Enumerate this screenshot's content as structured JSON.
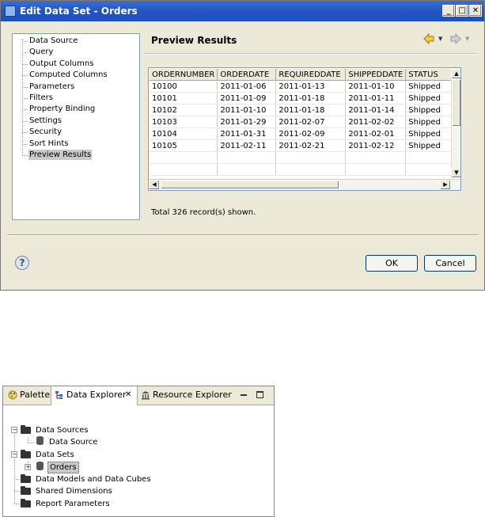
{
  "dialog": {
    "title": "Edit Data Set - Orders",
    "nav_items": [
      "Data Source",
      "Query",
      "Output Columns",
      "Computed Columns",
      "Parameters",
      "Filters",
      "Property Binding",
      "Settings",
      "Security",
      "Sort Hints",
      "Preview Results"
    ],
    "selected_nav": "Preview Results",
    "page_title": "Preview Results",
    "table": {
      "columns": [
        "ORDERNUMBER",
        "ORDERDATE",
        "REQUIREDDATE",
        "SHIPPEDDATE",
        "STATUS"
      ],
      "rows": [
        [
          "10100",
          "2011-01-06",
          "2011-01-13",
          "2011-01-10",
          "Shipped"
        ],
        [
          "10101",
          "2011-01-09",
          "2011-01-18",
          "2011-01-11",
          "Shipped"
        ],
        [
          "10102",
          "2011-01-10",
          "2011-01-18",
          "2011-01-14",
          "Shipped"
        ],
        [
          "10103",
          "2011-01-29",
          "2011-02-07",
          "2011-02-02",
          "Shipped"
        ],
        [
          "10104",
          "2011-01-31",
          "2011-02-09",
          "2011-02-01",
          "Shipped"
        ],
        [
          "10105",
          "2011-02-11",
          "2011-02-21",
          "2011-02-12",
          "Shipped"
        ]
      ]
    },
    "total_text": "Total 326 record(s) shown.",
    "ok_label": "OK",
    "cancel_label": "Cancel",
    "help_glyph": "?"
  },
  "panel": {
    "tabs": {
      "palette": "Palette",
      "explorer": "Data Explorer",
      "resource": "Resource Explorer"
    },
    "tree": {
      "data_sources": "Data Sources",
      "data_source": "Data Source",
      "data_sets": "Data Sets",
      "orders": "Orders",
      "data_models": "Data Models and Data Cubes",
      "shared_dimensions": "Shared Dimensions",
      "report_parameters": "Report Parameters"
    }
  },
  "colors": {
    "titlebar": "#2456c4",
    "dialog_bg": "#ece9d8",
    "selection": "#c9c9c9"
  }
}
